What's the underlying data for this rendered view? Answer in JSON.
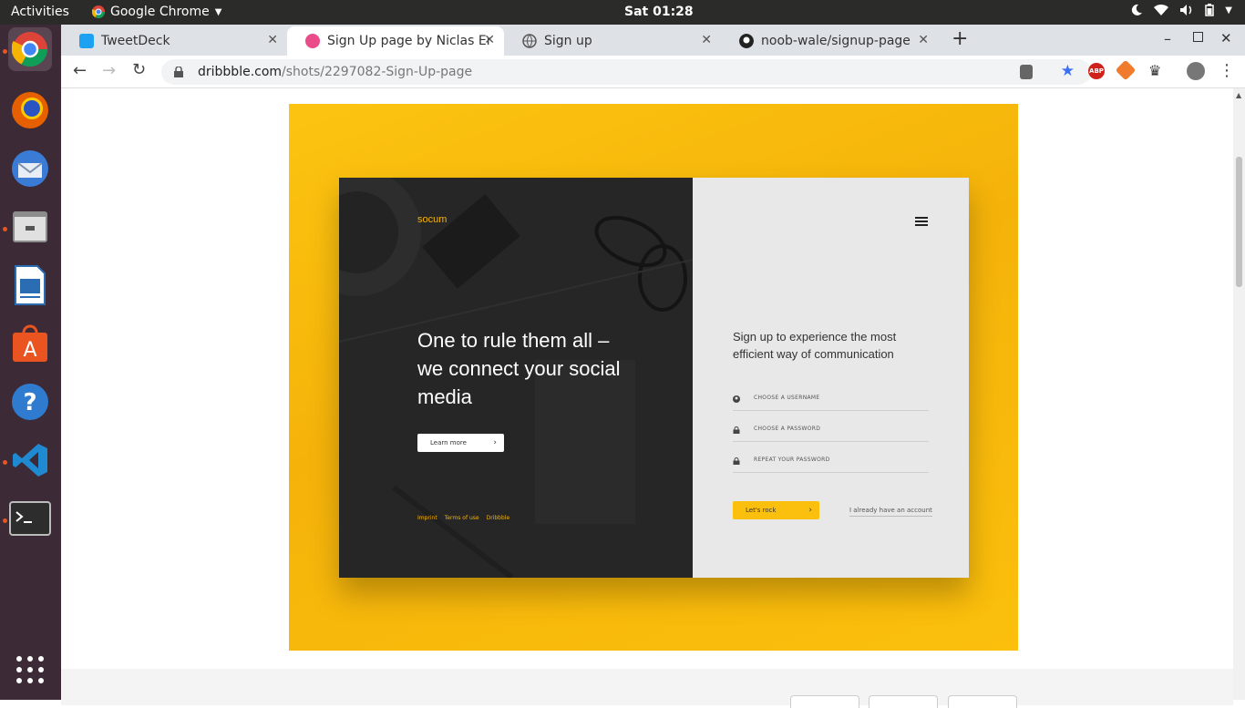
{
  "system": {
    "activities": "Activities",
    "app_name": "Google Chrome",
    "clock": "Sat 01:28"
  },
  "tabs": [
    {
      "title": "TweetDeck",
      "icon": "twitter-icon",
      "color": "#1da1f2"
    },
    {
      "title": "Sign Up page by Niclas Er",
      "icon": "dribbble-icon",
      "color": "#ea4c89"
    },
    {
      "title": "Sign up",
      "icon": "globe-icon",
      "color": "#555555"
    },
    {
      "title": "noob-wale/signup-page",
      "icon": "github-icon",
      "color": "#222222"
    }
  ],
  "url": {
    "domain": "dribbble.com",
    "path": "/shots/2297082-Sign-Up-page"
  },
  "shot": {
    "brand": "socum",
    "headline": "One to rule them all – we connect your social media",
    "learn_more": "Learn more",
    "footer_links": [
      "Imprint",
      "Terms of use",
      "Dribbble"
    ],
    "signup_heading": "Sign up to experience the most efficient way of communication",
    "fields": [
      {
        "label": "CHOOSE A USERNAME",
        "icon": "user-icon"
      },
      {
        "label": "CHOOSE A PASSWORD",
        "icon": "lock-icon"
      },
      {
        "label": "REPEAT YOUR PASSWORD",
        "icon": "lock-icon"
      }
    ],
    "submit": "Let's rock",
    "login_link": "I already have an account"
  },
  "colors": {
    "accent": "#f5b30a",
    "dark": "#252525",
    "light": "#e8e8e8"
  }
}
